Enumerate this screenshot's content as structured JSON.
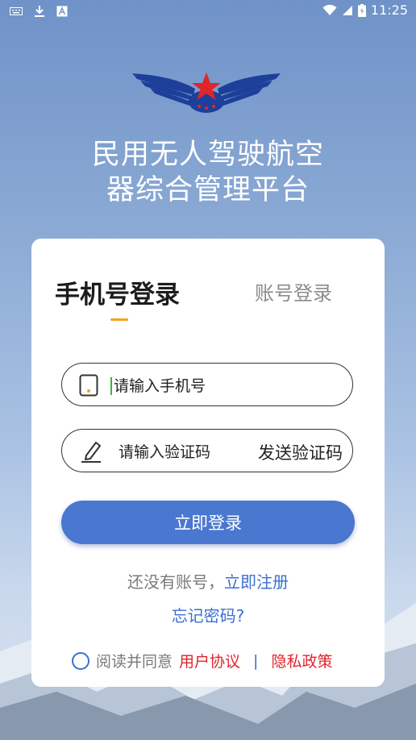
{
  "status_bar": {
    "time": "11:25",
    "icons": [
      "keyboard-icon",
      "download-icon",
      "font-icon",
      "wifi-icon",
      "signal-icon",
      "battery-icon"
    ]
  },
  "header": {
    "title_line1": "民用无人驾驶航空",
    "title_line2": "器综合管理平台"
  },
  "tabs": {
    "phone_login": "手机号登录",
    "account_login": "账号登录",
    "active": "phone_login"
  },
  "form": {
    "phone_placeholder": "请输入手机号",
    "code_placeholder": "请输入验证码",
    "send_code": "发送验证码",
    "login_button": "立即登录"
  },
  "links": {
    "no_account": "还没有账号，",
    "register": "立即注册",
    "forgot_password": "忘记密码?"
  },
  "agreement": {
    "read_agree": "阅读并同意",
    "user_agreement": "用户协议",
    "separator": "|",
    "privacy_policy": "隐私政策",
    "checked": false
  },
  "colors": {
    "primary": "#4a77cf",
    "link_blue": "#3b6fcf",
    "link_red": "#e0252b",
    "tab_indicator": "#f4a21b",
    "logo_star": "#e0252b",
    "logo_wing": "#1d3f9a"
  }
}
